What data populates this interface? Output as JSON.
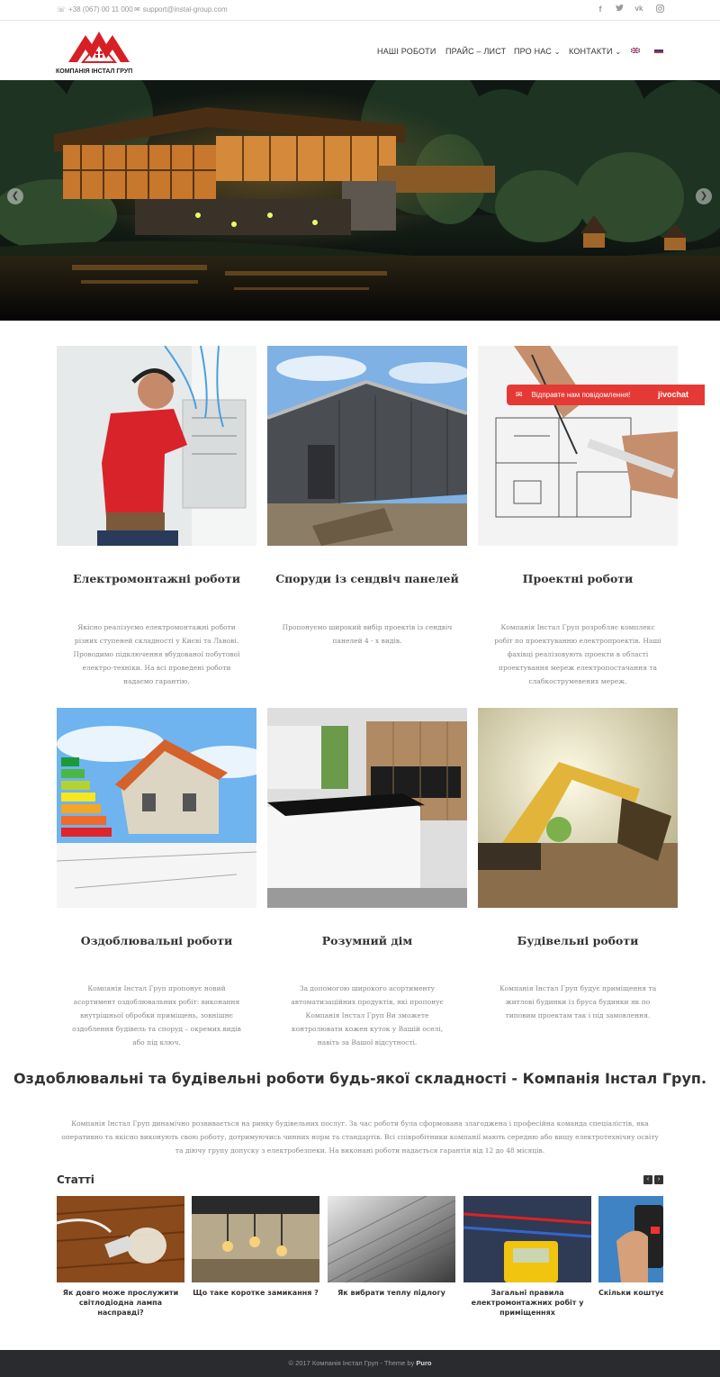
{
  "topbar": {
    "phone": "+38 (067) 00 11 000",
    "email": "support@instal-group.com",
    "social": [
      "facebook-icon",
      "twitter-icon",
      "vk-icon",
      "instagram-icon"
    ]
  },
  "header": {
    "logo_text": "КОМПАНІЯ ІНСТАЛ ГРУП",
    "nav": [
      "НАШІ РОБОТИ",
      "ПРАЙС – ЛИСТ",
      "ПРО НАС",
      "КОНТАКТИ"
    ],
    "nav_dropdown_marker": "⌄",
    "languages": [
      "English",
      "Русский"
    ]
  },
  "chat": {
    "label": "Відправте нам повідомлення!",
    "brand": "jivochat"
  },
  "services": [
    {
      "title": "Електромонтажні роботи",
      "description": "Якісно реалізуємо електромонтажні роботи різних ступеней складності у Києві та Львові. Проводимо підключення вбудованої побутової електро-техніки. На всі проведені роботи надаємо гарантію."
    },
    {
      "title": "Споруди із сендвіч панелей",
      "description": "Пропонуємо широкий вибір проектів із сендвіч панелей 4 - х видів."
    },
    {
      "title": "Проектні роботи",
      "description": "Компанія Інстал Груп розробляє комплекс робіт по проектуванню електропроектів. Наші фахівці реалізовують проекти в області проектування мереж електропостачання та слабкострумевених мереж."
    },
    {
      "title": "Оздоблювальні роботи",
      "description": "Компанія Інстал Груп пропонує новий асортимент оздоблювальних робіт: виконання внутрішньої обробки приміщень, зовнішнє оздоблення будівель та споруд – окремих видів або під ключ."
    },
    {
      "title": "Розумний дім",
      "description": "За допомогою широкого асортименту автоматизаційних продуктів, які пропонує Компанія Інстал Груп Ви зможете контролювати кожен куток у Вашій оселі, навіть за Вашої відсутності."
    },
    {
      "title": "Будівельні роботи",
      "description": "Компанія Інстал Груп будує приміщення та житлові будинки із бруса будинки як по типовим проектам так і під замовлення."
    }
  ],
  "main": {
    "headline": "Оздоблювальні та будівельні роботи будь-якої складності - Компанія Інстал Груп.",
    "paragraph": "Компанія Інстал Груп динамічно розвивається на ринку будівельних послуг. За час роботи була сформована злагоджена і професійна команда спеціалістів, яка оперативно та якісно виконують свою роботу, дотримуючись чинних норм та стандартів. Всі співробітники компанії мають середню або вищу електротехнічну освіту та діючу групу допуску з електробезпеки. На виконані роботи надається гарантія від 12 до 48 місяців."
  },
  "articles": {
    "title": "Статті",
    "prev": "‹",
    "next": "›",
    "items": [
      "Як довго може прослужити світлодіодна лампа насправді?",
      "Що таке коротке замикання ?",
      "Як вибрати теплу підлогу",
      "Загальні правила електромонтажних робіт у приміщеннях",
      "Скільки коштує..."
    ]
  },
  "footer": {
    "copyright": "© 2017 Компанія Інстал Груп - Theme by ",
    "theme": "Puro"
  },
  "colors": {
    "accent": "#e53935",
    "footer_bg": "#2a2b2e"
  }
}
